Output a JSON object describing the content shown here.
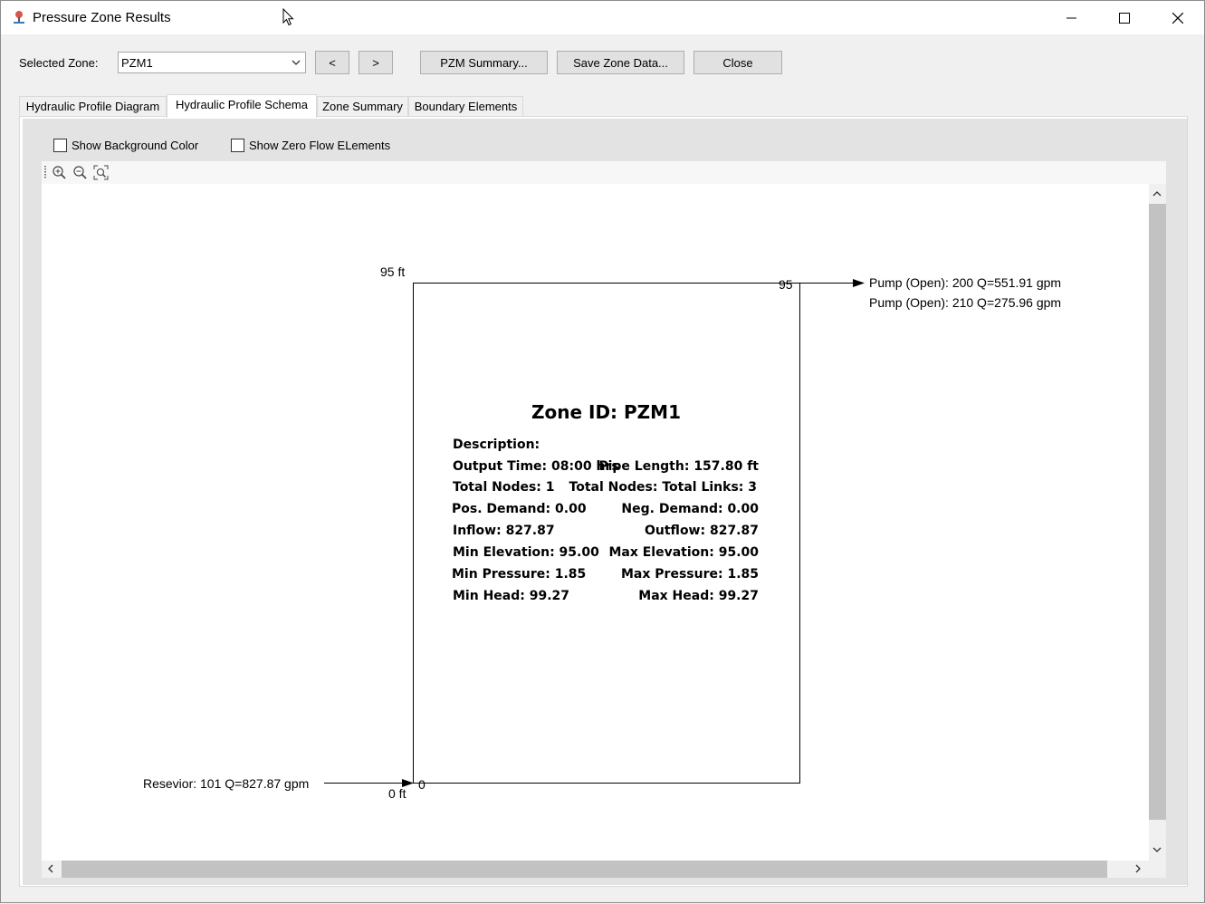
{
  "window": {
    "title": "Pressure Zone Results",
    "minimize_glyph": "—",
    "maximize_glyph": "☐",
    "close_glyph": "✕"
  },
  "toolbar": {
    "selected_zone_label": "Selected Zone:",
    "selected_zone_value": "PZM1",
    "prev_label": "<",
    "next_label": ">",
    "pzm_summary_label": "PZM Summary...",
    "save_zone_data_label": "Save Zone Data...",
    "close_label": "Close"
  },
  "tabs": [
    {
      "label": "Hydraulic Profile Diagram",
      "active": false
    },
    {
      "label": "Hydraulic Profile Schema",
      "active": true
    },
    {
      "label": "Zone Summary",
      "active": false
    },
    {
      "label": "Boundary Elements",
      "active": false
    }
  ],
  "options": {
    "show_background_color": {
      "label": "Show Background Color",
      "checked": false
    },
    "show_zero_flow_elements": {
      "label": "Show Zero Flow ELements",
      "checked": false
    }
  },
  "view_tools": [
    "zoom-in-icon",
    "zoom-out-icon",
    "zoom-fit-icon"
  ],
  "diagram": {
    "top_elevation_label": "95 ft",
    "top_node_value": "95",
    "bottom_elevation_label": "0 ft",
    "bottom_node_value": "0",
    "outlets": [
      "Pump (Open): 200 Q=551.91 gpm",
      "Pump (Open): 210 Q=275.96 gpm"
    ],
    "inlet": "Resevior: 101 Q=827.87 gpm",
    "zone_info": {
      "title": "Zone ID: PZM1",
      "rows": [
        {
          "left": "Description:",
          "right": ""
        },
        {
          "left": "Output Time: 08:00 hrs",
          "right": "Pipe Length: 157.80 ft"
        },
        {
          "left": "Total Nodes: 1",
          "right": "Total Nodes: Total Links: 3"
        },
        {
          "left": "Pos. Demand: 0.00",
          "right": "Neg. Demand: 0.00"
        },
        {
          "left": "Inflow: 827.87",
          "right": "Outflow: 827.87"
        },
        {
          "left": "Min Elevation: 95.00",
          "right": "Max Elevation: 95.00"
        },
        {
          "left": "Min Pressure: 1.85",
          "right": "Max Pressure: 1.85"
        },
        {
          "left": "Min Head: 99.27",
          "right": "Max Head: 99.27"
        }
      ]
    }
  }
}
